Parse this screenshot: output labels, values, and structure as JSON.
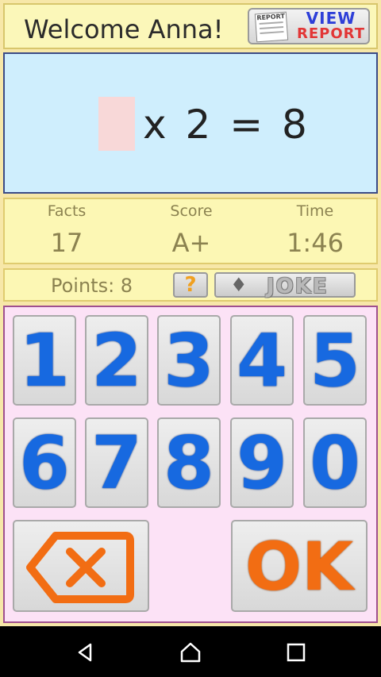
{
  "header": {
    "welcome": "Welcome Anna!",
    "view_report": {
      "doc_label": "REPORT",
      "line1": "VIEW",
      "line2": "REPORT"
    }
  },
  "equation": {
    "answer": "",
    "text": "x 2 = 8"
  },
  "stats": {
    "facts": {
      "label": "Facts",
      "value": "17"
    },
    "score": {
      "label": "Score",
      "value": "A+"
    },
    "time": {
      "label": "Time",
      "value": "1:46"
    }
  },
  "points_bar": {
    "points": "Points: 8",
    "help": "?",
    "joke": "JOKE"
  },
  "keypad": {
    "digits": [
      "1",
      "2",
      "3",
      "4",
      "5",
      "6",
      "7",
      "8",
      "9",
      "0"
    ],
    "ok": "OK",
    "backspace_icon": "backspace-icon"
  },
  "navbar": {
    "icons": [
      "back-icon",
      "home-icon",
      "recents-icon"
    ]
  },
  "colors": {
    "digit_blue": "#1769e0",
    "ok_orange": "#f26d13",
    "equation_bg": "#cfeefd",
    "keypad_bg": "#fce2f6"
  }
}
